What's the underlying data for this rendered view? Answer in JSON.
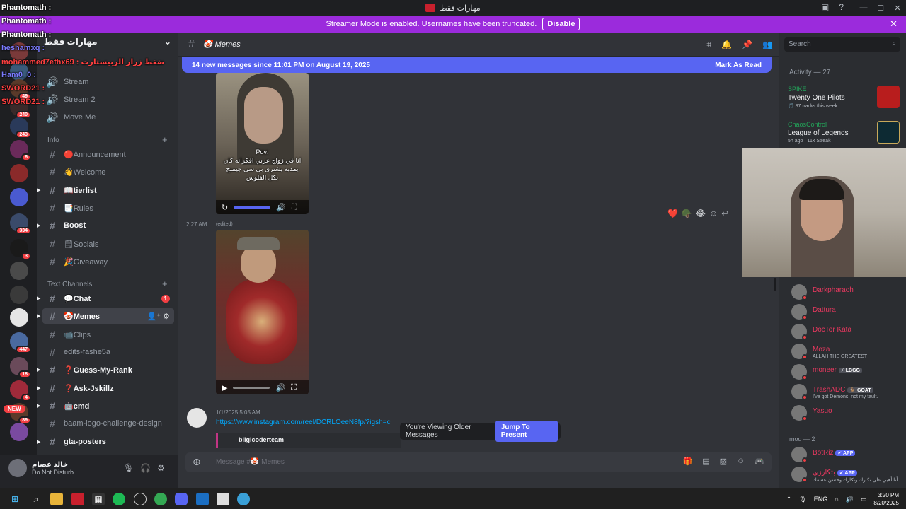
{
  "window": {
    "title": "مهارات فقط"
  },
  "banner": {
    "text": "Streamer Mode is enabled. Usernames have been truncated.",
    "disable": "Disable"
  },
  "chat_overlay": [
    {
      "user": "Phantomath :",
      "color": "#ffffff"
    },
    {
      "user": "Phantomath :",
      "color": "#ffffff"
    },
    {
      "user": "Phantomath :",
      "color": "#ffffff"
    },
    {
      "user": "heshamxq :",
      "color": "#7b7bff"
    },
    {
      "user": "mohammed7efhx69 : ضغط زرار الربيستارت",
      "color": "#ff4040"
    },
    {
      "user": "Ham0_0 :",
      "color": "#7b7bff"
    },
    {
      "user": "SWORD21 :",
      "color": "#ff4040"
    },
    {
      "user": "SWORD21 :",
      "color": "#ff4040"
    }
  ],
  "server": {
    "name": "مهارات فقط"
  },
  "servers": [
    {
      "badge": ""
    },
    {
      "badge": ""
    },
    {
      "badge": "49"
    },
    {
      "badge": "240"
    },
    {
      "badge": "243"
    },
    {
      "badge": "6"
    },
    {
      "badge": ""
    },
    {
      "badge": ""
    },
    {
      "badge": "334"
    },
    {
      "badge": "3"
    },
    {
      "badge": ""
    },
    {
      "badge": ""
    },
    {
      "badge": ""
    },
    {
      "badge": "447"
    },
    {
      "badge": "18"
    },
    {
      "badge": "4"
    },
    {
      "badge": "89"
    },
    {
      "badge": ""
    }
  ],
  "new_label": "NEW",
  "voice_channels": [
    "Stream",
    "Stream 2",
    "Move Me"
  ],
  "categories": {
    "info": "Info",
    "text": "Text Channels"
  },
  "info_channels": [
    {
      "name": "Announcement",
      "emoji": "🔴",
      "bold": false
    },
    {
      "name": "Welcome",
      "emoji": "👋",
      "bold": false
    },
    {
      "name": "tierlist",
      "emoji": "📖",
      "bold": true
    },
    {
      "name": "Rules",
      "emoji": "📑",
      "bold": false
    },
    {
      "name": "Boost",
      "emoji": "",
      "bold": true
    },
    {
      "name": "Socials",
      "emoji": "🗒",
      "bold": false
    },
    {
      "name": "Giveaway",
      "emoji": "🎉",
      "bold": false
    }
  ],
  "text_channels": [
    {
      "name": "Chat",
      "emoji": "💬",
      "bold": true,
      "unread": "1"
    },
    {
      "name": "Memes",
      "emoji": "🤡",
      "bold": true,
      "active": true
    },
    {
      "name": "Clips",
      "emoji": "📹",
      "bold": false
    },
    {
      "name": "edits-fashe5a",
      "emoji": "",
      "bold": false
    },
    {
      "name": "Guess-My-Rank",
      "emoji": "❓",
      "bold": true
    },
    {
      "name": "Ask-Jskillz",
      "emoji": "❓",
      "bold": true
    },
    {
      "name": "cmd",
      "emoji": "🤖",
      "bold": true
    },
    {
      "name": "baam-logo-challenge-design",
      "emoji": "",
      "bold": false
    },
    {
      "name": "gta-posters",
      "emoji": "",
      "bold": true
    }
  ],
  "user": {
    "name": "خالد عصام",
    "status": "Do Not Disturb"
  },
  "channel": {
    "name": "Memes",
    "emoji": "🤡"
  },
  "new_messages": {
    "text": "14 new messages since 11:01 PM on August 19, 2025",
    "action": "Mark As Read"
  },
  "video1": {
    "caption": "Pov:\nانا في زواج عربي افكرانه كان\nيمدبه يشترى بى سى جيمنج\nبكل الفلوس"
  },
  "message_time": "2:27 AM",
  "edited": "(edited)",
  "reactions": [
    "❤️",
    "🪖",
    "😂"
  ],
  "link_message": {
    "time": "1/1/2025 5:05 AM",
    "link": "https://www.instagram.com/reel/DCRLOeeN8fp/?igsh=c",
    "embed_author": "bilgicoderteam"
  },
  "older": {
    "text": "You're Viewing Older Messages",
    "jump": "Jump To Present"
  },
  "composer": {
    "placeholder": "Message #🤡 Memes"
  },
  "search": {
    "placeholder": "Search"
  },
  "activity": {
    "header": "Activity — 27",
    "items": [
      {
        "who": "SPIKE",
        "what": "Twenty One Pilots",
        "sub": "🎵 87 tracks this week"
      },
      {
        "who": "ChaosControl",
        "what": "League of Legends",
        "sub": "5h ago  ·  11x Streak"
      }
    ]
  },
  "members": [
    {
      "name": "Darkpharaoh",
      "status": "",
      "tag": ""
    },
    {
      "name": "Dattura",
      "status": "",
      "tag": ""
    },
    {
      "name": "DocTor Kata",
      "status": "",
      "tag": ""
    },
    {
      "name": "Moza",
      "status": "ALLAH THE GREATEST",
      "tag": ""
    },
    {
      "name": "moneer",
      "status": "",
      "tag": "⚡ LBGG"
    },
    {
      "name": "TrashADC",
      "status": "I've got Demons, not my fault.",
      "tag": "🐐 GOAT"
    },
    {
      "name": "Yasuo",
      "status": "",
      "tag": ""
    }
  ],
  "mod_header": "mod — 2",
  "mods": [
    {
      "name": "BotRiz",
      "status": "",
      "tag": "✔ APP"
    },
    {
      "name": "بتكارزي",
      "status": "أنا أهبي على تكارك وتكارك وحسن عشقك...",
      "tag": "✔ APP"
    }
  ],
  "taskbar": {
    "lang": "ENG",
    "time": "3:20 PM",
    "date": "8/20/2025"
  }
}
